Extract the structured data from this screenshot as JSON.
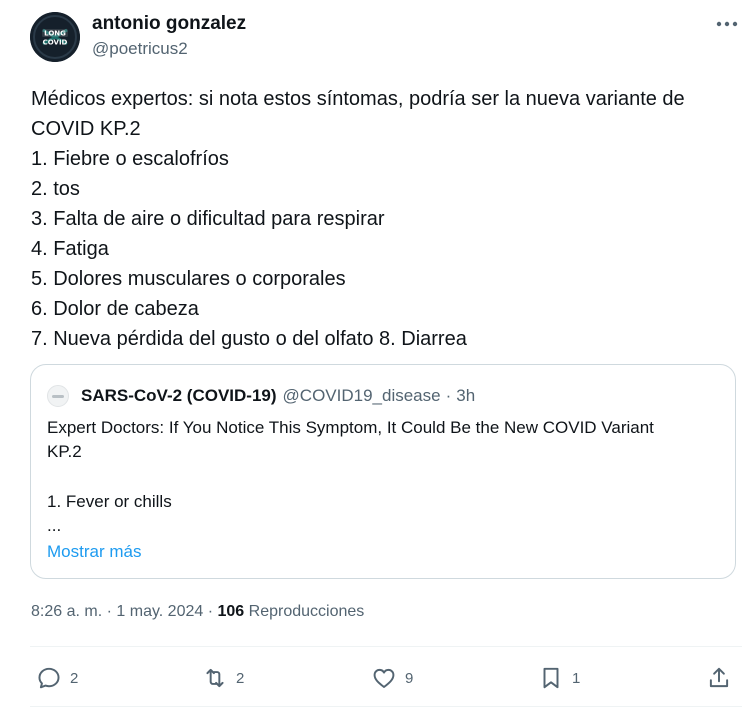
{
  "author": {
    "display_name": "antonio gonzalez",
    "handle": "@poetricus2",
    "avatar_text": [
      "LONG",
      "COVID"
    ]
  },
  "tweet": {
    "lines": [
      "Médicos expertos: si nota estos síntomas, podría ser la nueva variante de",
      "COVID KP.2",
      "1. Fiebre o escalofríos",
      "2. tos",
      "3. Falta de aire o dificultad para respirar",
      "4. Fatiga",
      "5. Dolores musculares o corporales",
      "6. Dolor de cabeza",
      "7. Nueva pérdida del gusto o del olfato 8. Diarrea"
    ]
  },
  "quote": {
    "name": "SARS-CoV-2 (COVID-19)",
    "handle": "@COVID19_disease",
    "separator": "·",
    "time": "3h",
    "lines": [
      "Expert Doctors: If You Notice This Symptom, It Could Be the New COVID Variant",
      "KP.2",
      "",
      "1. Fever or chills",
      "..."
    ],
    "show_more": "Mostrar más"
  },
  "meta": {
    "time": "8:26 a. m.",
    "separator": "·",
    "date": "1 may. 2024",
    "views_count": "106",
    "views_label": "Reproducciones"
  },
  "actions": {
    "reply": {
      "icon": "reply-icon",
      "count": "2"
    },
    "retweet": {
      "icon": "retweet-icon",
      "count": "2"
    },
    "like": {
      "icon": "heart-icon",
      "count": "9"
    },
    "bookmark": {
      "icon": "bookmark-icon",
      "count": "1"
    },
    "share": {
      "icon": "share-icon"
    }
  },
  "colors": {
    "text": "#0f1419",
    "secondary": "#536471",
    "link": "#1d9bf0",
    "border": "#cfd9de"
  }
}
